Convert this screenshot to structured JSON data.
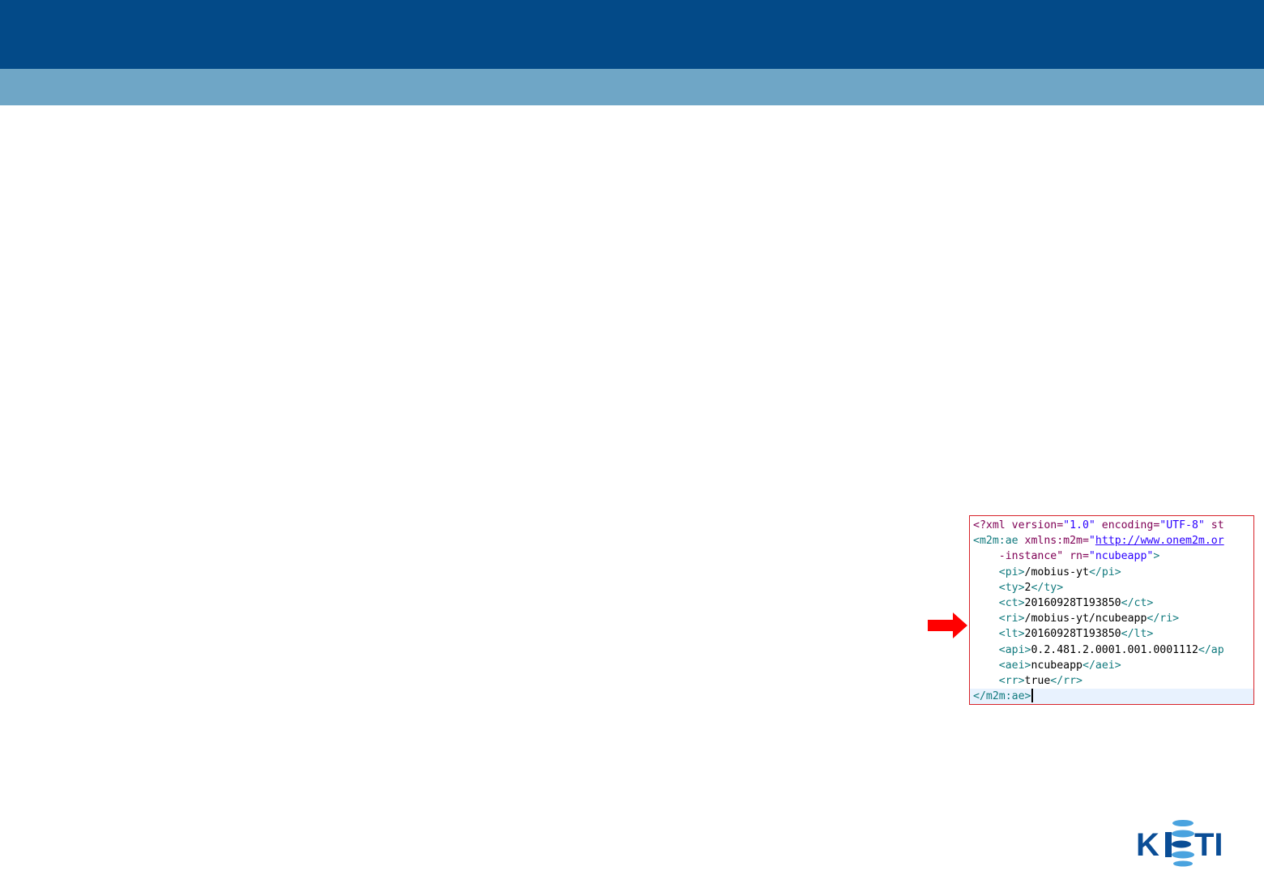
{
  "header": {
    "primary_color": "#034a88",
    "secondary_color": "#6fa6c6"
  },
  "xml_panel": {
    "border_color": "#d8232a",
    "lines": [
      [
        {
          "t": "attr",
          "v": "<?xml version="
        },
        {
          "t": "val",
          "v": "\"1.0\""
        },
        {
          "t": "attr",
          "v": " encoding="
        },
        {
          "t": "val",
          "v": "\"UTF-8\""
        },
        {
          "t": "attr",
          "v": " st"
        }
      ],
      [
        {
          "t": "tag",
          "v": "<m2m:ae"
        },
        {
          "t": "attr",
          "v": " xmlns:m2m="
        },
        {
          "t": "val",
          "v": "\""
        },
        {
          "t": "link",
          "v": "http://www.onem2m.or"
        }
      ],
      [
        {
          "t": "attr",
          "v": "    -instance\" rn="
        },
        {
          "t": "val",
          "v": "\"ncubeapp\""
        },
        {
          "t": "tag",
          "v": ">"
        }
      ],
      [
        {
          "t": "tag",
          "v": "    <pi>"
        },
        {
          "t": "text",
          "v": "/mobius-yt"
        },
        {
          "t": "tag",
          "v": "</pi>"
        }
      ],
      [
        {
          "t": "tag",
          "v": "    <ty>"
        },
        {
          "t": "text",
          "v": "2"
        },
        {
          "t": "tag",
          "v": "</ty>"
        }
      ],
      [
        {
          "t": "tag",
          "v": "    <ct>"
        },
        {
          "t": "text",
          "v": "20160928T193850"
        },
        {
          "t": "tag",
          "v": "</ct>"
        }
      ],
      [
        {
          "t": "tag",
          "v": "    <ri>"
        },
        {
          "t": "text",
          "v": "/mobius-yt/ncubeapp"
        },
        {
          "t": "tag",
          "v": "</ri>"
        }
      ],
      [
        {
          "t": "tag",
          "v": "    <lt>"
        },
        {
          "t": "text",
          "v": "20160928T193850"
        },
        {
          "t": "tag",
          "v": "</lt>"
        }
      ],
      [
        {
          "t": "tag",
          "v": "    <api>"
        },
        {
          "t": "text",
          "v": "0.2.481.2.0001.001.0001112"
        },
        {
          "t": "tag",
          "v": "</ap"
        }
      ],
      [
        {
          "t": "tag",
          "v": "    <aei>"
        },
        {
          "t": "text",
          "v": "ncubeapp"
        },
        {
          "t": "tag",
          "v": "</aei>"
        }
      ],
      [
        {
          "t": "tag",
          "v": "    <rr>"
        },
        {
          "t": "text",
          "v": "true"
        },
        {
          "t": "tag",
          "v": "</rr>"
        }
      ],
      [
        {
          "t": "tag",
          "v": "</m2m:ae>"
        }
      ]
    ],
    "current_line": 11
  },
  "arrow": {
    "color": "#ff0000",
    "icon": "right-arrow-icon"
  },
  "logo": {
    "text": "KETI",
    "color": "#0a4d96",
    "dot_color": "#4aa3df"
  }
}
